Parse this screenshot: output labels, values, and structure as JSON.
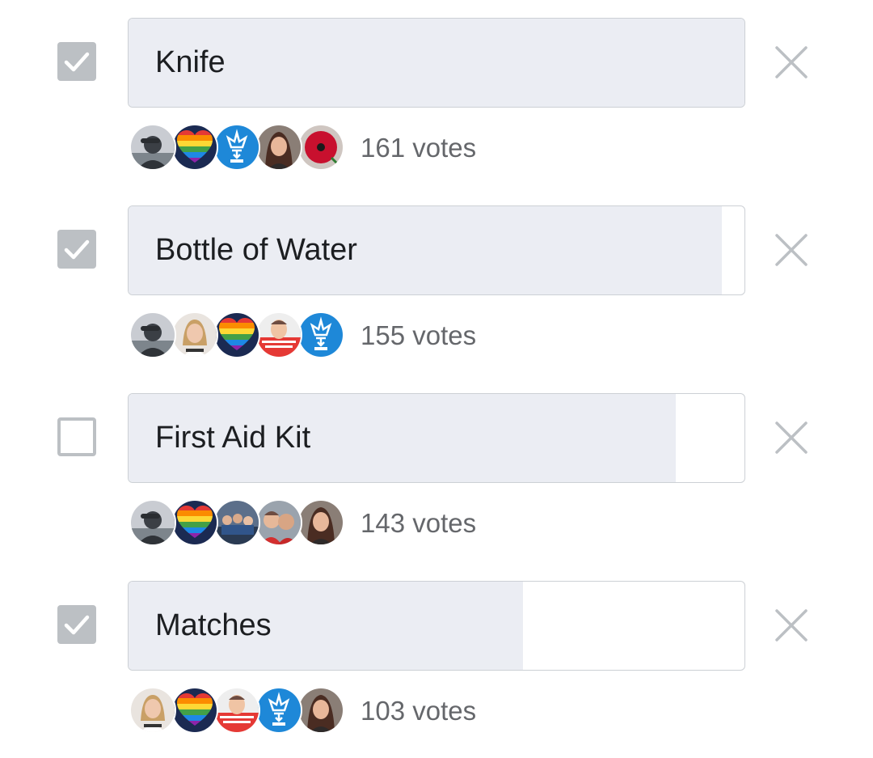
{
  "options": [
    {
      "label": "Knife",
      "checked": true,
      "votes_text": "161 votes",
      "fill_fraction": 1.0,
      "voters": [
        "avatar-person-cap",
        "avatar-rainbow-heart",
        "avatar-scout-badge",
        "avatar-person-brunette",
        "avatar-poppy"
      ]
    },
    {
      "label": "Bottle of Water",
      "checked": true,
      "votes_text": "155 votes",
      "fill_fraction": 0.963,
      "voters": [
        "avatar-person-cap",
        "avatar-person-blonde",
        "avatar-rainbow-heart",
        "avatar-staying-home",
        "avatar-scout-badge"
      ]
    },
    {
      "label": "First Aid Kit",
      "checked": false,
      "votes_text": "143 votes",
      "fill_fraction": 0.888,
      "voters": [
        "avatar-person-cap",
        "avatar-rainbow-heart",
        "avatar-group-photo",
        "avatar-couple-photo",
        "avatar-person-brunette"
      ]
    },
    {
      "label": "Matches",
      "checked": true,
      "votes_text": "103 votes",
      "fill_fraction": 0.64,
      "voters": [
        "avatar-person-blonde",
        "avatar-rainbow-heart",
        "avatar-staying-home",
        "avatar-scout-badge",
        "avatar-person-brunette"
      ]
    }
  ],
  "icons": {
    "checkbox_checked": "check-icon",
    "remove": "close-icon"
  },
  "colors": {
    "fill": "#ebedf3",
    "checkbox": "#bcc0c4",
    "label_text": "#1c1e21",
    "meta_text": "#65676b",
    "close_icon": "#bcc0c4"
  }
}
